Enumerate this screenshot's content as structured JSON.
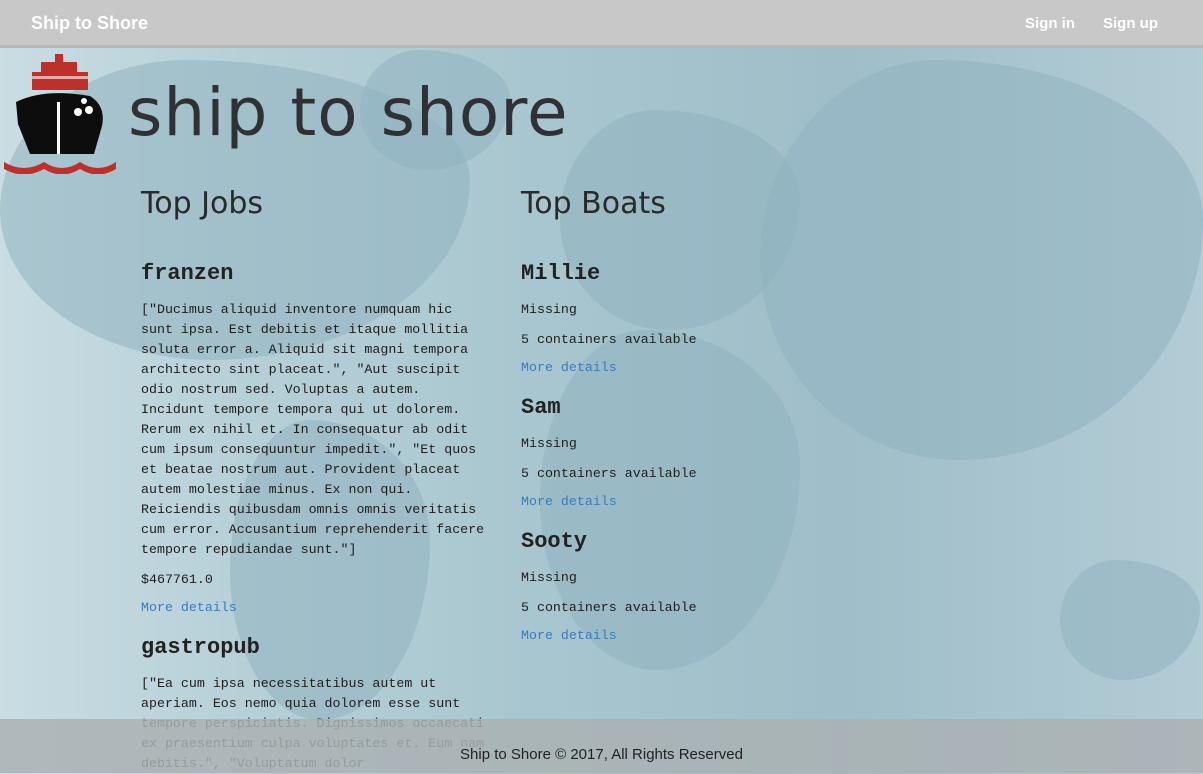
{
  "nav": {
    "brand": "Ship to Shore",
    "sign_in": "Sign in",
    "sign_up": "Sign up"
  },
  "header": {
    "logo_text": "ship to shore"
  },
  "jobs": {
    "heading": "Top Jobs",
    "items": [
      {
        "title": "franzen",
        "description": "[\"Ducimus aliquid inventore numquam hic sunt ipsa. Est debitis et itaque mollitia soluta error a. Aliquid sit magni tempora architecto sint placeat.\", \"Aut suscipit odio nostrum sed. Voluptas a autem. Incidunt tempore tempora qui ut dolorem. Rerum ex nihil et. In consequatur ab odit cum ipsum consequuntur impedit.\", \"Et quos et beatae nostrum aut. Provident placeat autem molestiae minus. Ex non qui. Reiciendis quibusdam omnis omnis veritatis cum error. Accusantium reprehenderit facere tempore repudiandae sunt.\"]",
        "price": "$467761.0",
        "link": "More details"
      },
      {
        "title": "gastropub",
        "description": "[\"Ea cum ipsa necessitatibus autem ut aperiam. Eos nemo quia dolorem esse sunt tempore perspiciatis. Dignissimos occaecati ex praesentium culpa voluptates et. Eum nam debitis.\", \"Voluptatum dolor"
      }
    ]
  },
  "boats": {
    "heading": "Top Boats",
    "items": [
      {
        "name": "Millie",
        "status": "Missing",
        "containers": "5 containers available",
        "link": "More details"
      },
      {
        "name": "Sam",
        "status": "Missing",
        "containers": "5 containers available",
        "link": "More details"
      },
      {
        "name": "Sooty",
        "status": "Missing",
        "containers": "5 containers available",
        "link": "More details"
      }
    ]
  },
  "footer": {
    "text": "Ship to Shore © 2017, All Rights Reserved"
  },
  "colors": {
    "navbar": "#c8c8c8",
    "link": "#3a7bbd",
    "logo_red": "#c0302b"
  }
}
